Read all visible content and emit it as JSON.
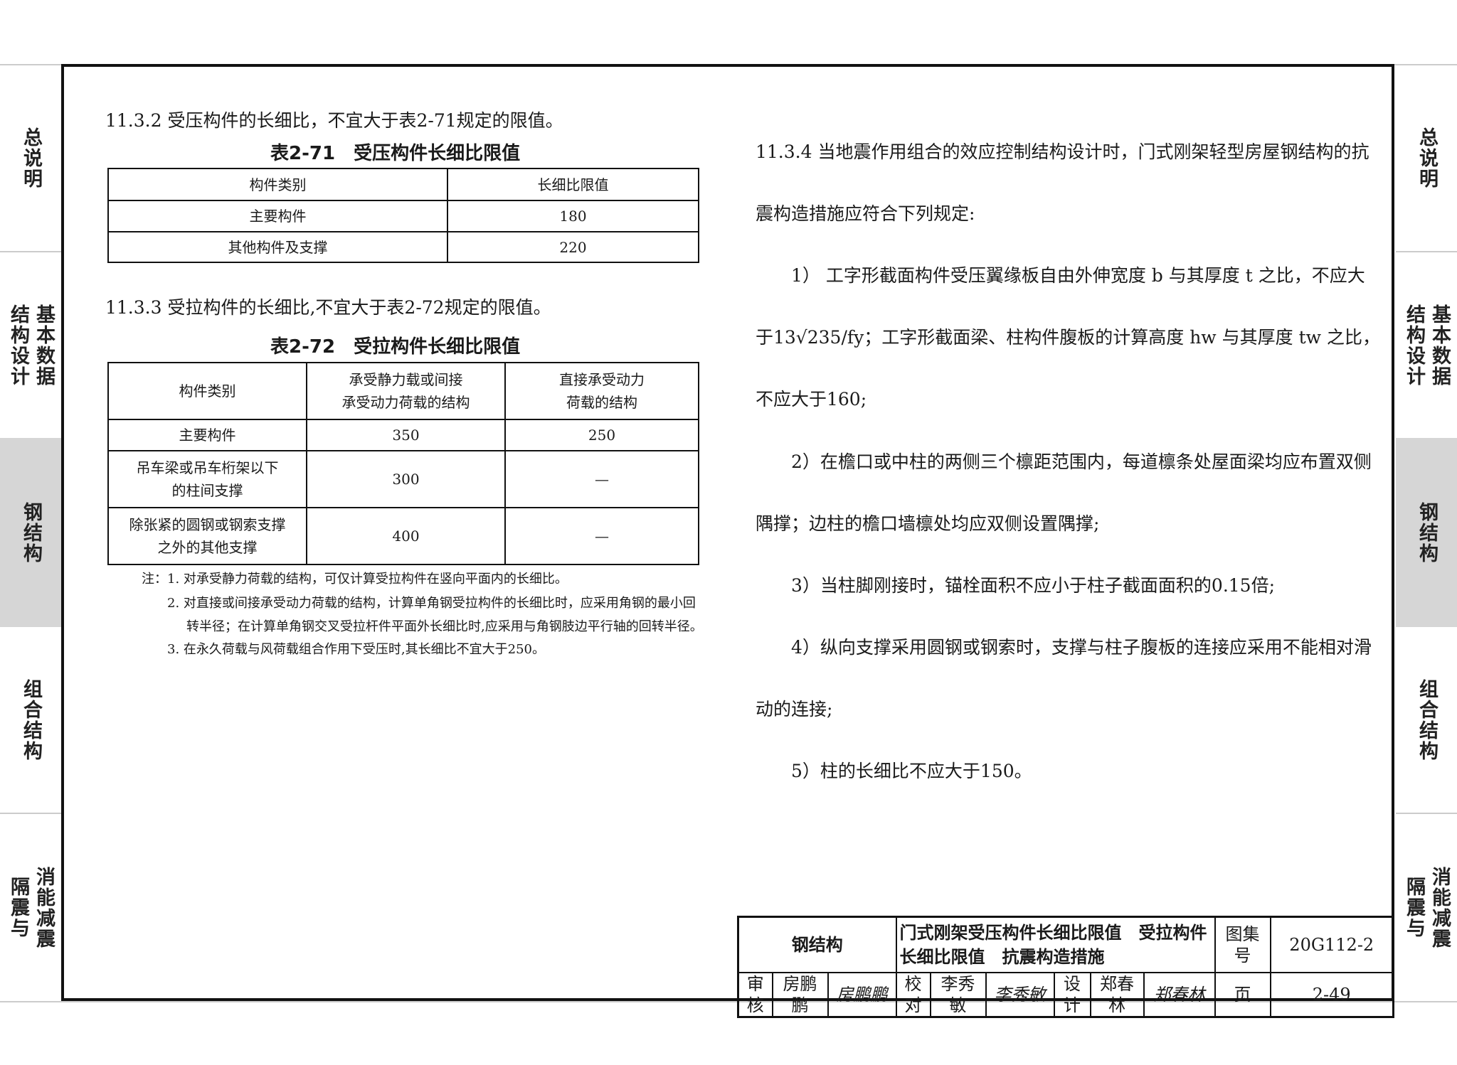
{
  "side_tabs": [
    {
      "label": "总说明"
    },
    {
      "label": "基本数据",
      "label2": "结构设计"
    },
    {
      "label": "钢结构",
      "active": true
    },
    {
      "label": "组合结构"
    },
    {
      "label": "消能减震",
      "label2": "隔震与"
    }
  ],
  "left": {
    "s1132": "11.3.2 受压构件的长细比，不宜大于表2-71规定的限值。",
    "t71_caption": "表2-71　受压构件长细比限值",
    "t71": {
      "headers": [
        "构件类别",
        "长细比限值"
      ],
      "rows": [
        [
          "主要构件",
          "180"
        ],
        [
          "其他构件及支撑",
          "220"
        ]
      ]
    },
    "s1133": "11.3.3 受拉构件的长细比,不宜大于表2-72规定的限值。",
    "t72_caption": "表2-72　受拉构件长细比限值",
    "t72": {
      "headers": [
        "构件类别",
        "承受静力载或间接\n承受动力荷载的结构",
        "直接承受动力\n荷载的结构"
      ],
      "rows": [
        [
          "主要构件",
          "350",
          "250"
        ],
        [
          "吊车梁或吊车桁架以下\n的柱间支撑",
          "300",
          "—"
        ],
        [
          "除张紧的圆钢或钢索支撑\n之外的其他支撑",
          "400",
          "—"
        ]
      ]
    },
    "notes": [
      "注：1. 对承受静力荷载的结构，可仅计算受拉构件在竖向平面内的长细比。",
      "2. 对直接或间接承受动力荷载的结构，计算单角钢受拉构件的长细比时，应采用角钢的最小回",
      "转半径；在计算单角钢交叉受拉杆件平面外长细比时,应采用与角钢肢边平行轴的回转半径。",
      "3. 在永久荷载与风荷载组合作用下受压时,其长细比不宜大于250。"
    ]
  },
  "right": {
    "lines": [
      "11.3.4 当地震作用组合的效应控制结构设计时，门式刚架轻型房屋钢结构的抗",
      "震构造措施应符合下列规定:",
      "　　1） 工字形截面构件受压翼缘板自由外伸宽度 b 与其厚度 t 之比，不应大",
      "于13√235/fy；工字形截面梁、柱构件腹板的计算高度 hw 与其厚度 tw 之比，",
      "不应大于160;",
      "　　2）在檐口或中柱的两侧三个檩距范围内，每道檩条处屋面梁均应布置双侧",
      "隅撑；边柱的檐口墙檩处均应双侧设置隅撑;",
      "　　3）当柱脚刚接时，锚栓面积不应小于柱子截面面积的0.15倍;",
      "　　4）纵向支撑采用圆钢或钢索时，支撑与柱子腹板的连接应采用不能相对滑",
      "动的连接;",
      "　　5）柱的长细比不应大于150。"
    ]
  },
  "title_block": {
    "category": "钢结构",
    "title": "门式刚架受压构件长细比限值　受拉构件长细比限值　抗震构造措施",
    "atlas_label": "图集号",
    "atlas_no": "20G112-2",
    "review_label": "审核",
    "reviewer": "房鹏鹏",
    "reviewer_sig": "房鹏鹏",
    "check_label": "校对",
    "checker": "李秀敏",
    "checker_sig": "李秀敏",
    "design_label": "设计",
    "designer": "郑春林",
    "designer_sig": "郑春林",
    "page_label": "页",
    "page_no": "2-49"
  }
}
